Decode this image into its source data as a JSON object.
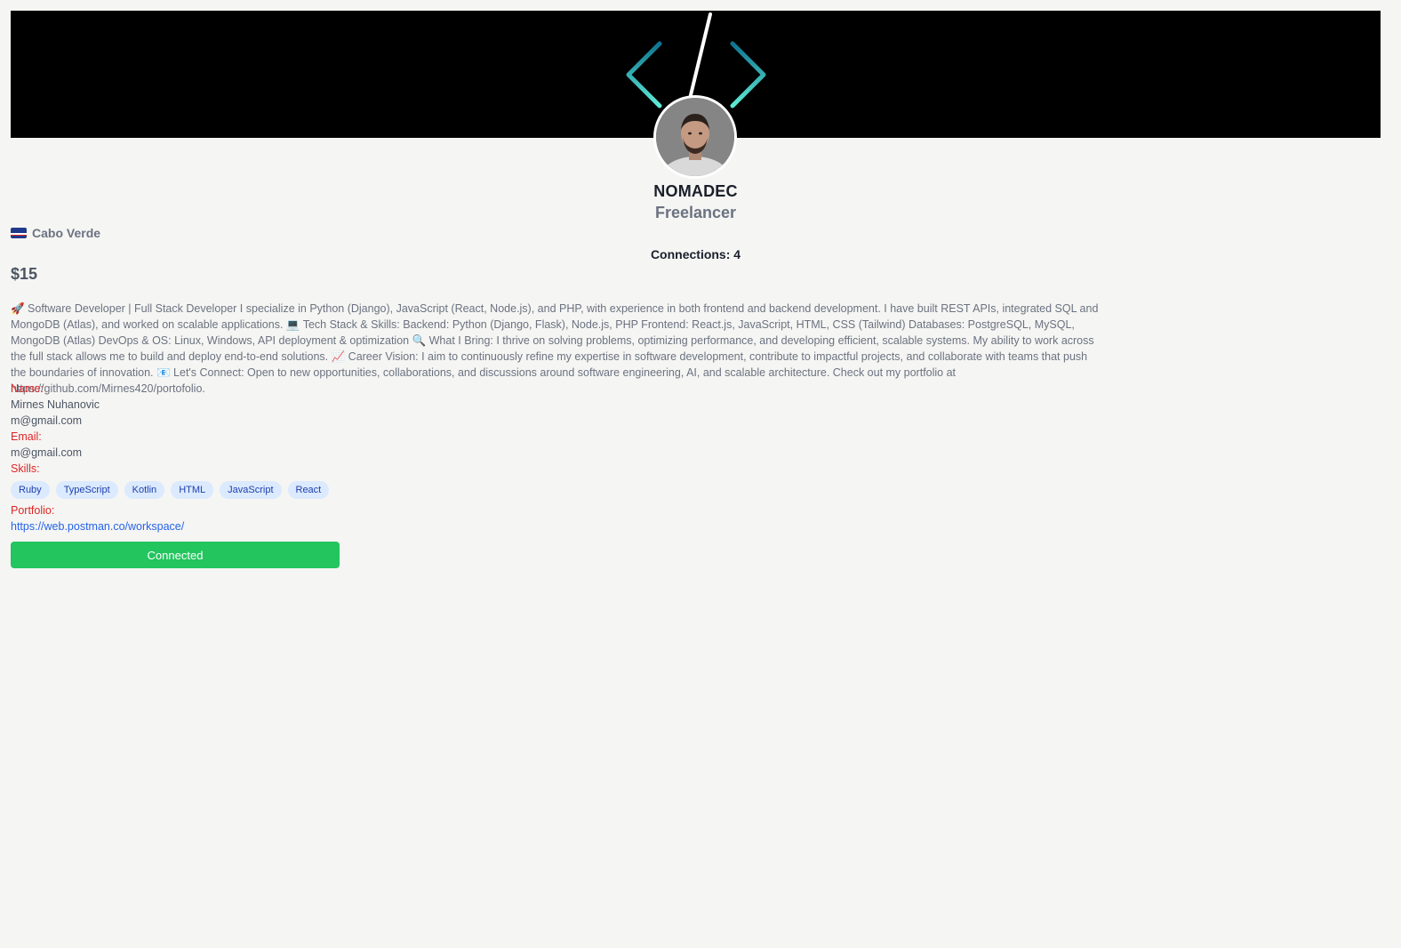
{
  "profile": {
    "username": "NOMADEC",
    "role": "Freelancer",
    "location": "Cabo Verde",
    "connections_label": "Connections: 4",
    "rate": "$15",
    "bio": "🚀 Software Developer | Full Stack Developer I specialize in Python (Django), JavaScript (React, Node.js), and PHP, with experience in both frontend and backend development. I have built REST APIs, integrated SQL and MongoDB (Atlas), and worked on scalable applications. 💻 Tech Stack & Skills: Backend: Python (Django, Flask), Node.js, PHP Frontend: React.js, JavaScript, HTML, CSS (Tailwind) Databases: PostgreSQL, MySQL, MongoDB (Atlas) DevOps & OS: Linux, Windows, API deployment & optimization 🔍 What I Bring: I thrive on solving problems, optimizing performance, and developing efficient, scalable systems. My ability to work across the full stack allows me to build and deploy end-to-end solutions. 📈 Career Vision: I aim to continuously refine my expertise in software development, contribute to impactful projects, and collaborate with teams that push the boundaries of innovation. 📧 Let's Connect: Open to new opportunities, collaborations, and discussions around software engineering, AI, and scalable architecture. Check out my portfolio at https://github.com/Mirnes420/portofolio."
  },
  "details": {
    "name_label": "Name:",
    "name_value": "Mirnes Nuhanovic",
    "name_email": "m@gmail.com",
    "email_label": "Email:",
    "email_value": "m@gmail.com",
    "skills_label": "Skills:",
    "skills": [
      "Ruby",
      "TypeScript",
      "Kotlin",
      "HTML",
      "JavaScript",
      "React"
    ],
    "portfolio_label": "Portfolio:",
    "portfolio_url": "https://web.postman.co/workspace/"
  },
  "actions": {
    "connect_label": "Connected"
  },
  "icons": {
    "banner_left": "chevron-left-icon",
    "banner_right": "chevron-right-icon",
    "location_flag": "cabo-verde-flag-icon"
  },
  "colors": {
    "banner_bg": "#000000",
    "accent_teal": "#2dd4bf",
    "label_red": "#dc2626",
    "link_blue": "#2563eb",
    "connect_green": "#22c55e",
    "chip_bg": "#dbeafe",
    "chip_text": "#1e40af"
  }
}
